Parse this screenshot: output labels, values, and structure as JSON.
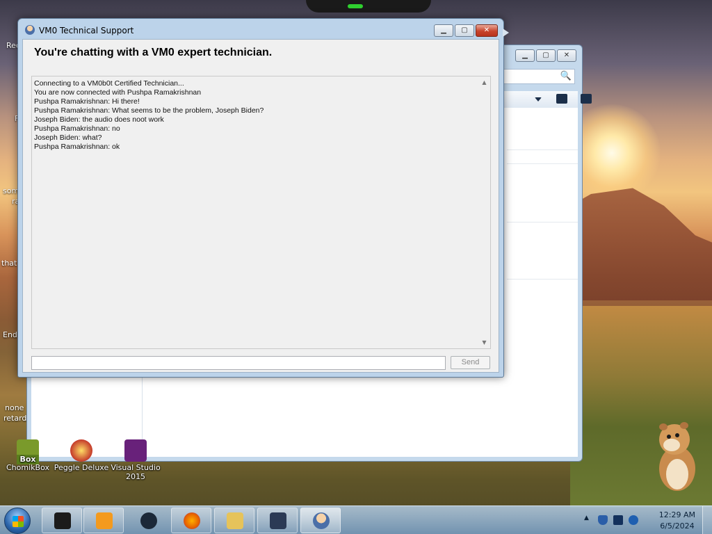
{
  "desktop": {
    "icons": [
      {
        "label": "ChomikBox",
        "color": "#7a9a2b"
      },
      {
        "label": "Peggle Deluxe",
        "color": "#c43a2a"
      },
      {
        "label": "Visual Studio 2015",
        "color": "#68217a"
      }
    ],
    "partial_labels": [
      "Rec",
      "F",
      "som",
      "ra",
      "that",
      "End",
      "none",
      "retards"
    ],
    "chomik_badge": "Box"
  },
  "chat_window": {
    "title": "VM0 Technical Support",
    "heading": "You're chatting with a VM0 expert technician.",
    "messages": [
      "Connecting to a VM0b0t Certified Technician...",
      "You are now connected with Pushpa Ramakrishnan",
      "Pushpa Ramakrishnan: Hi there!",
      "Pushpa Ramakrishnan: What seems to be the problem, Joseph Biden?",
      "Joseph Biden: the audio does noot work",
      "Pushpa Ramakrishnan: no",
      "Joseph Biden: what?",
      "Pushpa Ramakrishnan: ok"
    ],
    "input_value": "",
    "send_label": "Send",
    "buttons": {
      "minimize": "▁",
      "maximize": "▢",
      "close": "✕"
    }
  },
  "background_window": {
    "buttons": {
      "minimize": "▁",
      "maximize": "▢",
      "close": "✕"
    },
    "search_icon": "🔍"
  },
  "taskbar": {
    "items": [
      {
        "name": "taskbar-item-black-box",
        "color": "#1b1b1b"
      },
      {
        "name": "taskbar-item-media-player",
        "color": "#f39a1e"
      },
      {
        "name": "taskbar-item-steam",
        "color": "#1b2838"
      },
      {
        "name": "taskbar-item-firefox",
        "color": "#e66000"
      },
      {
        "name": "taskbar-item-explorer",
        "color": "#e6c35a"
      },
      {
        "name": "taskbar-item-monitor",
        "color": "#2b3a55"
      },
      {
        "name": "taskbar-item-vm0-support",
        "color": "#f3c79a"
      }
    ],
    "clock": {
      "time": "12:29 AM",
      "date": "6/5/2024"
    }
  }
}
